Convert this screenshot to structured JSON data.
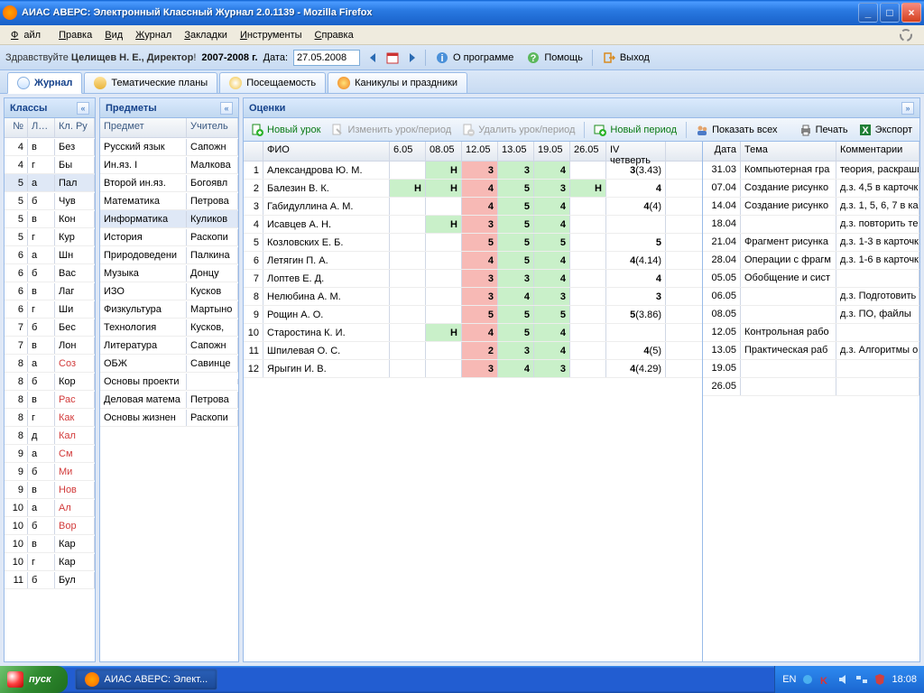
{
  "titlebar": {
    "text": "АИАС АВЕРС: Электронный Классный Журнал 2.0.1139 - Mozilla Firefox"
  },
  "menubar": {
    "file": "Файл",
    "edit": "Правка",
    "view": "Вид",
    "journal": "Журнал",
    "bookmarks": "Закладки",
    "tools": "Инструменты",
    "help": "Справка"
  },
  "toolbar": {
    "greeting_prefix": "Здравствуйте ",
    "greeting_name": "Целищев Н. Е., Директор",
    "year": "2007-2008 г.",
    "date_label": "Дата:",
    "date_value": "27.05.2008",
    "about": "О программе",
    "helpbtn": "Помощь",
    "exit": "Выход"
  },
  "tabs": {
    "journal": "Журнал",
    "themes": "Тематические планы",
    "attendance": "Посещаемость",
    "holidays": "Каникулы и праздники"
  },
  "panels": {
    "classes": "Классы",
    "subjects": "Предметы",
    "grades": "Оценки"
  },
  "classes": {
    "hd_no": "№",
    "hd_lit": "Лите",
    "hd_kr": "Кл. Ру",
    "rows": [
      {
        "no": "4",
        "lit": "в",
        "kr": "Без"
      },
      {
        "no": "4",
        "lit": "г",
        "kr": "Бы"
      },
      {
        "no": "5",
        "lit": "а",
        "kr": "Пал",
        "sel": true
      },
      {
        "no": "5",
        "lit": "б",
        "kr": "Чув"
      },
      {
        "no": "5",
        "lit": "в",
        "kr": "Кон"
      },
      {
        "no": "5",
        "lit": "г",
        "kr": "Кур"
      },
      {
        "no": "6",
        "lit": "а",
        "kr": "Шн"
      },
      {
        "no": "6",
        "lit": "б",
        "kr": "Вас"
      },
      {
        "no": "6",
        "lit": "в",
        "kr": "Лаг"
      },
      {
        "no": "6",
        "lit": "г",
        "kr": "Ши"
      },
      {
        "no": "7",
        "lit": "б",
        "kr": "Бес"
      },
      {
        "no": "7",
        "lit": "в",
        "kr": "Лон"
      },
      {
        "no": "8",
        "lit": "а",
        "kr": "Соз",
        "red": true
      },
      {
        "no": "8",
        "lit": "б",
        "kr": "Кор"
      },
      {
        "no": "8",
        "lit": "в",
        "kr": "Рас",
        "red": true
      },
      {
        "no": "8",
        "lit": "г",
        "kr": "Как",
        "red": true
      },
      {
        "no": "8",
        "lit": "д",
        "kr": "Кал",
        "red": true
      },
      {
        "no": "9",
        "lit": "а",
        "kr": "См",
        "red": true
      },
      {
        "no": "9",
        "lit": "б",
        "kr": "Ми",
        "red": true
      },
      {
        "no": "9",
        "lit": "в",
        "kr": "Нов",
        "red": true
      },
      {
        "no": "10",
        "lit": "а",
        "kr": "Ал",
        "red": true
      },
      {
        "no": "10",
        "lit": "б",
        "kr": "Вор",
        "red": true
      },
      {
        "no": "10",
        "lit": "в",
        "kr": "Кар"
      },
      {
        "no": "10",
        "lit": "г",
        "kr": "Кар"
      },
      {
        "no": "11",
        "lit": "б",
        "kr": "Бул"
      }
    ]
  },
  "subjects": {
    "hd_sub": "Предмет",
    "hd_tch": "Учитель",
    "rows": [
      {
        "s": "Русский язык",
        "t": "Сапожн"
      },
      {
        "s": "Ин.яз. I",
        "t": "Малкова"
      },
      {
        "s": "Второй ин.яз.",
        "t": "Богоявл"
      },
      {
        "s": "Математика",
        "t": "Петрова"
      },
      {
        "s": "Информатика",
        "t": "Куликов",
        "sel": true
      },
      {
        "s": "История",
        "t": "Раскопи"
      },
      {
        "s": "Природоведени",
        "t": "Палкина"
      },
      {
        "s": "Музыка",
        "t": "Донцу"
      },
      {
        "s": "ИЗО",
        "t": "Кусков"
      },
      {
        "s": "Физкультура",
        "t": "Мартыно"
      },
      {
        "s": "Технология",
        "t": "Кусков,"
      },
      {
        "s": "Литература",
        "t": "Сапожн"
      },
      {
        "s": "ОБЖ",
        "t": "Савинце"
      },
      {
        "s": "Основы проекти",
        "t": ""
      },
      {
        "s": "Деловая матема",
        "t": "Петрова"
      },
      {
        "s": "Основы жизнен",
        "t": "Раскопи"
      }
    ]
  },
  "subtb": {
    "new_lesson": "Новый урок",
    "edit_lesson": "Изменить урок/период",
    "del_lesson": "Удалить урок/период",
    "new_period": "Новый период",
    "show_all": "Показать всех",
    "print": "Печать",
    "export": "Экспорт"
  },
  "grades": {
    "hd_fio": "ФИО",
    "hd_qtr": "IV четверть",
    "dates": [
      "6.05",
      "08.05",
      "12.05",
      "13.05",
      "19.05",
      "26.05"
    ],
    "rows": [
      {
        "n": "1",
        "fio": "Александрова Ю. М.",
        "d": [
          "",
          "Н",
          "3",
          "3",
          "4",
          ""
        ],
        "q": "3 (3.43)"
      },
      {
        "n": "2",
        "fio": "Балезин В. К.",
        "d": [
          "Н",
          "Н",
          "4",
          "5",
          "3",
          "Н"
        ],
        "q": "4"
      },
      {
        "n": "3",
        "fio": "Габидуллина А. М.",
        "d": [
          "",
          "",
          "4",
          "5",
          "4",
          ""
        ],
        "q": "4 (4)"
      },
      {
        "n": "4",
        "fio": "Исавцев А. Н.",
        "d": [
          "",
          "Н",
          "3",
          "5",
          "4",
          ""
        ],
        "q": ""
      },
      {
        "n": "5",
        "fio": "Козловских Е. Б.",
        "d": [
          "",
          "",
          "5",
          "5",
          "5",
          ""
        ],
        "q": "5"
      },
      {
        "n": "6",
        "fio": "Летягин П. А.",
        "d": [
          "",
          "",
          "4",
          "5",
          "4",
          ""
        ],
        "q": "4 (4.14)"
      },
      {
        "n": "7",
        "fio": "Лоптев Е. Д.",
        "d": [
          "",
          "",
          "3",
          "3",
          "4",
          ""
        ],
        "q": "4"
      },
      {
        "n": "8",
        "fio": "Нелюбина А. М.",
        "d": [
          "",
          "",
          "3",
          "4",
          "3",
          ""
        ],
        "q": "3"
      },
      {
        "n": "9",
        "fio": "Рощин А. О.",
        "d": [
          "",
          "",
          "5",
          "5",
          "5",
          ""
        ],
        "q": "5 (3.86)"
      },
      {
        "n": "10",
        "fio": "Старостина К. И.",
        "d": [
          "",
          "Н",
          "4",
          "5",
          "4",
          ""
        ],
        "q": ""
      },
      {
        "n": "11",
        "fio": "Шпилевая О. С.",
        "d": [
          "",
          "",
          "2",
          "3",
          "4",
          ""
        ],
        "q": "4 (5)"
      },
      {
        "n": "12",
        "fio": "Ярыгин И. В.",
        "d": [
          "",
          "",
          "3",
          "4",
          "3",
          ""
        ],
        "q": "4 (4.29)"
      }
    ]
  },
  "lessons": {
    "hd_dt": "Дата",
    "hd_tm": "Тема",
    "hd_cm": "Комментарии",
    "rows": [
      {
        "d": "31.03",
        "t": "Компьютерная гра",
        "c": "теория, раскраши"
      },
      {
        "d": "07.04",
        "t": "Создание рисунко",
        "c": "д.з. 4,5 в карточк"
      },
      {
        "d": "14.04",
        "t": "Создание рисунко",
        "c": "д.з. 1, 5, 6, 7 в ка"
      },
      {
        "d": "18.04",
        "t": "",
        "c": "д.з. повторить те"
      },
      {
        "d": "21.04",
        "t": "Фрагмент рисунка",
        "c": "д.з. 1-3 в карточк"
      },
      {
        "d": "28.04",
        "t": "Операции с фрагм",
        "c": "д.з. 1-6 в карточк"
      },
      {
        "d": "05.05",
        "t": "Обобщение и сист",
        "c": ""
      },
      {
        "d": "06.05",
        "t": "",
        "c": "д.з. Подготовить"
      },
      {
        "d": "08.05",
        "t": "",
        "c": "д.з. ПО, файлы"
      },
      {
        "d": "12.05",
        "t": "Контрольная рабо",
        "c": ""
      },
      {
        "d": "13.05",
        "t": "Практическая раб",
        "c": "д.з. Алгоритмы оп"
      },
      {
        "d": "19.05",
        "t": "",
        "c": ""
      },
      {
        "d": "26.05",
        "t": "",
        "c": ""
      }
    ]
  },
  "taskbar": {
    "start": "пуск",
    "task": "АИАС АВЕРС: Элект...",
    "lang": "EN",
    "clock": "18:08"
  }
}
